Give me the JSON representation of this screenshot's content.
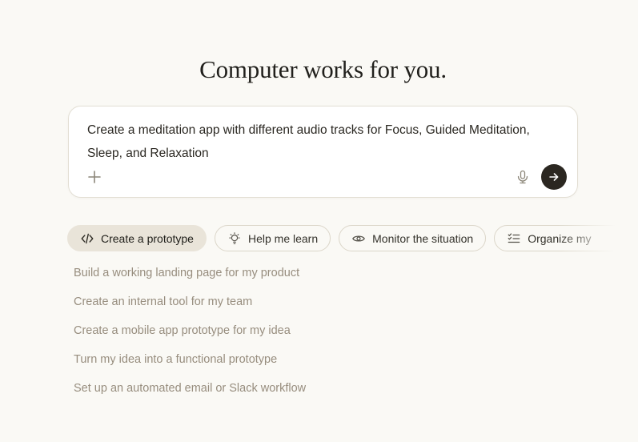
{
  "page": {
    "title": "Computer works for you.",
    "background_color": "#FAF9F5"
  },
  "composer": {
    "value": "Create a meditation app with different audio tracks for Focus, Guided Meditation, Sleep, and Relaxation",
    "attach_button": {
      "icon": "plus-icon"
    },
    "mic_button": {
      "icon": "microphone-icon"
    },
    "send_button": {
      "icon": "arrow-right-icon",
      "background_color": "#2B2721",
      "arrow_color": "#FFFFFF"
    }
  },
  "tabs": {
    "selected_background": "#E9E4D9",
    "items": [
      {
        "label": "Create a prototype",
        "icon": "code-icon",
        "selected": true
      },
      {
        "label": "Help me learn",
        "icon": "lightbulb-icon",
        "selected": false
      },
      {
        "label": "Monitor the situation",
        "icon": "eye-icon",
        "selected": false
      },
      {
        "label": "Organize my",
        "icon": "checklist-icon",
        "selected": false
      }
    ]
  },
  "suggestions": [
    "Build a working landing page for my product",
    "Create an internal tool for my team",
    "Create a mobile app prototype for my idea",
    "Turn my idea into a functional prototype",
    "Set up an automated email or Slack workflow"
  ],
  "colors": {
    "card_background": "#FFFFFF",
    "card_border": "#E3DFD4",
    "title_text": "#21201C",
    "input_text": "#2B2822",
    "muted_icon": "#8C8679",
    "tab_text": "#34322B",
    "tab_border": "#DBD6C9",
    "suggestion_text": "#978D7E"
  }
}
